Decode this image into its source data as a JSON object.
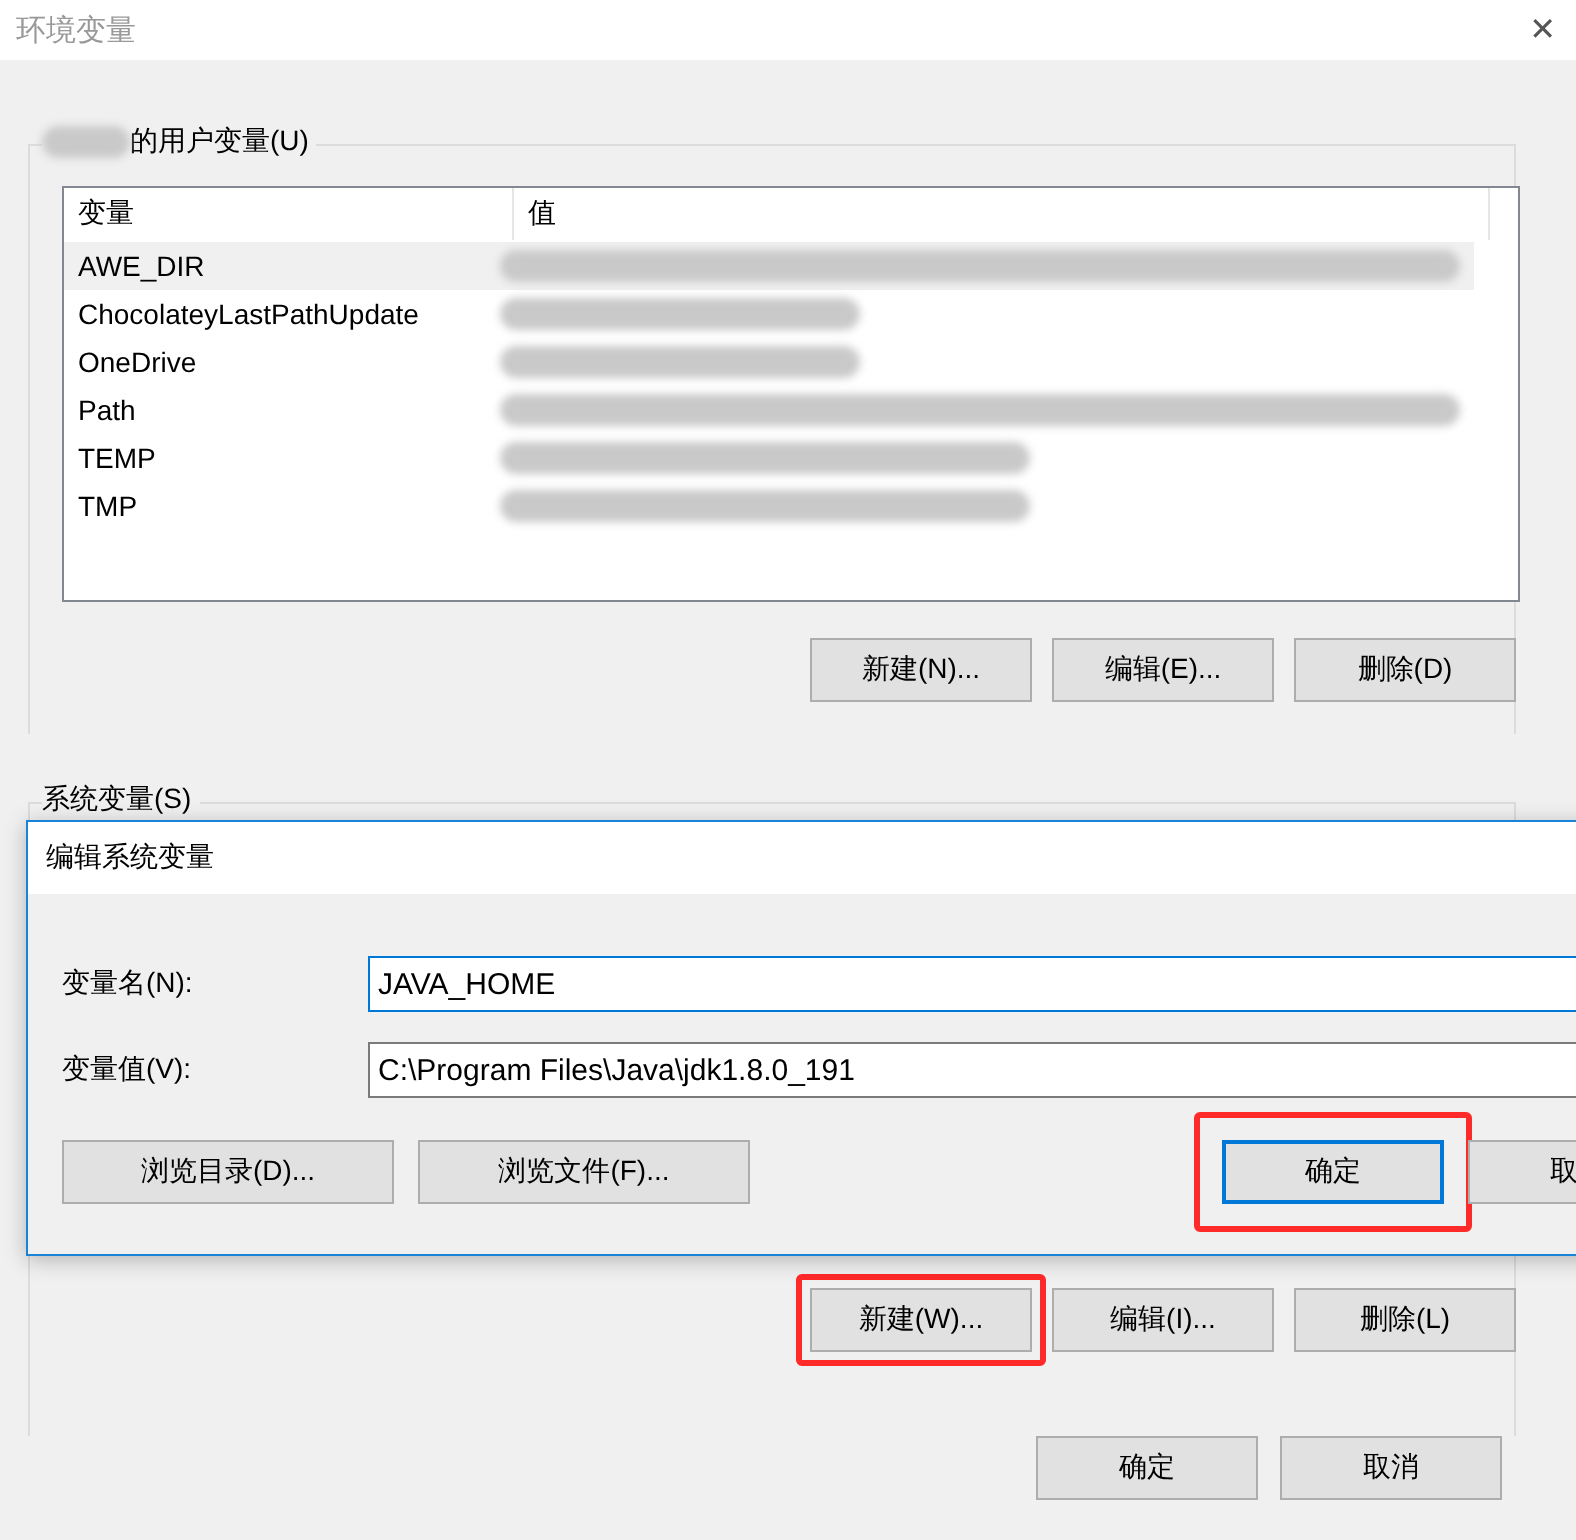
{
  "window": {
    "title": "环境变量",
    "close": "✕"
  },
  "user_variables": {
    "label": "的用户变量(U)",
    "owner_redacted": true,
    "columns": [
      "变量",
      "值"
    ],
    "rows": [
      {
        "name": "AWE_DIR",
        "value_redacted": true,
        "selected": true
      },
      {
        "name": "ChocolateyLastPathUpdate",
        "value_redacted": true,
        "selected": false
      },
      {
        "name": "OneDrive",
        "value_redacted": true,
        "selected": false
      },
      {
        "name": "Path",
        "value_redacted": true,
        "selected": false
      },
      {
        "name": "TEMP",
        "value_redacted": true,
        "selected": false
      },
      {
        "name": "TMP",
        "value_redacted": true,
        "selected": false
      }
    ],
    "buttons": [
      {
        "label": "新建(N)...",
        "highlighted": false
      },
      {
        "label": "编辑(E)...",
        "highlighted": false
      },
      {
        "label": "删除(D)",
        "highlighted": false
      }
    ]
  },
  "system_variables": {
    "label": "系统变量(S)",
    "buttons": [
      {
        "label": "新建(W)...",
        "highlighted": true
      },
      {
        "label": "编辑(I)...",
        "highlighted": false
      },
      {
        "label": "删除(L)",
        "highlighted": false
      }
    ]
  },
  "dialog": {
    "title": "编辑系统变量",
    "fields": [
      {
        "label": "变量名(N):",
        "value": "JAVA_HOME",
        "focused": true
      },
      {
        "label": "变量值(V):",
        "value": "C:\\Program Files\\Java\\jdk1.8.0_191",
        "focused": false
      }
    ],
    "browse_buttons": [
      {
        "label": "浏览目录(D)..."
      },
      {
        "label": "浏览文件(F)..."
      }
    ],
    "buttons": [
      {
        "label": "确定",
        "highlighted": true,
        "default": true
      },
      {
        "label": "取",
        "highlighted": false,
        "default": false
      }
    ]
  },
  "footer_buttons": [
    {
      "label": "确定"
    },
    {
      "label": "取消"
    }
  ]
}
